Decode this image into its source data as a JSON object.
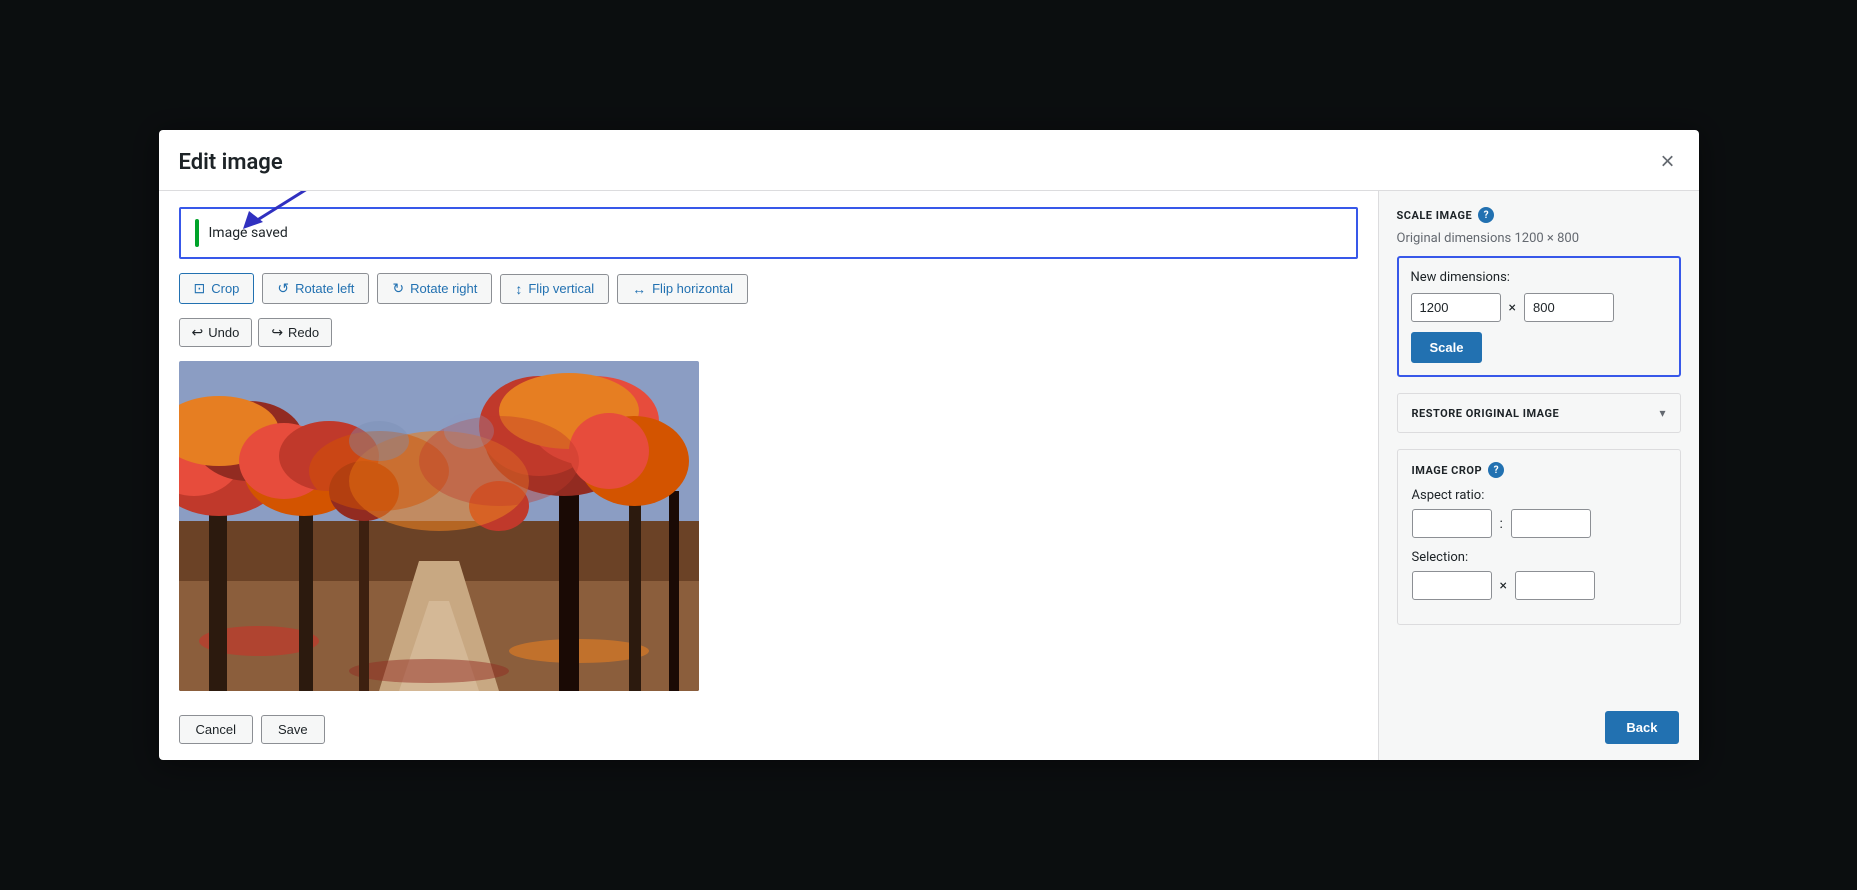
{
  "modal": {
    "title": "Edit image",
    "close_label": "×"
  },
  "notification": {
    "message": "Image saved"
  },
  "toolbar": {
    "crop_label": "Crop",
    "rotate_left_label": "Rotate left",
    "rotate_right_label": "Rotate right",
    "flip_vertical_label": "Flip vertical",
    "flip_horizontal_label": "Flip horizontal"
  },
  "undoredo": {
    "undo_label": "Undo",
    "redo_label": "Redo"
  },
  "footer": {
    "cancel_label": "Cancel",
    "save_label": "Save"
  },
  "sidebar": {
    "scale_title": "SCALE IMAGE",
    "original_dimensions": "Original dimensions 1200 × 800",
    "new_dimensions_label": "New dimensions:",
    "width_value": "1200",
    "height_value": "800",
    "scale_btn_label": "Scale",
    "restore_title": "RESTORE ORIGINAL IMAGE",
    "crop_title": "IMAGE CROP",
    "aspect_ratio_label": "Aspect ratio:",
    "selection_label": "Selection:",
    "aspect_w": "",
    "aspect_h": "",
    "sel_w": "",
    "sel_h": ""
  },
  "back_btn_label": "Back",
  "icons": {
    "crop": "⊡",
    "rotate_left": "↺",
    "rotate_right": "↻",
    "flip_v": "↕",
    "flip_h": "↔",
    "undo": "↩",
    "redo": "↪",
    "help": "?",
    "chevron_down": "▾",
    "close": "✕"
  }
}
